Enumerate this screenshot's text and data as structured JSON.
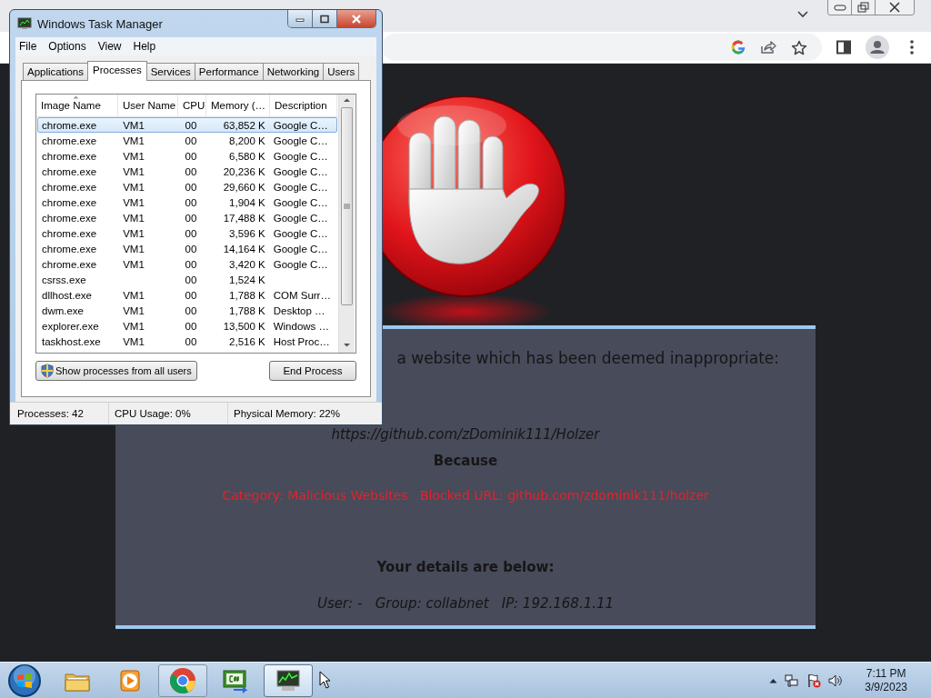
{
  "block_page": {
    "heading": "a website which has been deemed inappropriate:",
    "url": "https://github.com/zDominik111/Holzer",
    "because": "Because",
    "reason": "Category: Malicious Websites   Blocked URL: github.com/zdominik111/holzer",
    "details_heading": "Your details are below:",
    "details": "User: -   Group: collabnet   IP: 192.168.1.11"
  },
  "task_manager": {
    "title": "Windows Task Manager",
    "menu": [
      "File",
      "Options",
      "View",
      "Help"
    ],
    "tabs": [
      {
        "label": "Applications",
        "selected": false
      },
      {
        "label": "Processes",
        "selected": true
      },
      {
        "label": "Services",
        "selected": false
      },
      {
        "label": "Performance",
        "selected": false
      },
      {
        "label": "Networking",
        "selected": false
      },
      {
        "label": "Users",
        "selected": false
      }
    ],
    "columns": [
      {
        "label": "Image Name",
        "sorted": true
      },
      {
        "label": "User Name",
        "sorted": false
      },
      {
        "label": "CPU",
        "sorted": false
      },
      {
        "label": "Memory (…",
        "sorted": false
      },
      {
        "label": "Description",
        "sorted": false
      }
    ],
    "rows": [
      {
        "cells": [
          "chrome.exe",
          "VM1",
          "00",
          "63,852 K",
          "Google C…"
        ],
        "selected": true
      },
      {
        "cells": [
          "chrome.exe",
          "VM1",
          "00",
          "8,200 K",
          "Google C…"
        ],
        "selected": false
      },
      {
        "cells": [
          "chrome.exe",
          "VM1",
          "00",
          "6,580 K",
          "Google C…"
        ],
        "selected": false
      },
      {
        "cells": [
          "chrome.exe",
          "VM1",
          "00",
          "20,236 K",
          "Google C…"
        ],
        "selected": false
      },
      {
        "cells": [
          "chrome.exe",
          "VM1",
          "00",
          "29,660 K",
          "Google C…"
        ],
        "selected": false
      },
      {
        "cells": [
          "chrome.exe",
          "VM1",
          "00",
          "1,904 K",
          "Google C…"
        ],
        "selected": false
      },
      {
        "cells": [
          "chrome.exe",
          "VM1",
          "00",
          "17,488 K",
          "Google C…"
        ],
        "selected": false
      },
      {
        "cells": [
          "chrome.exe",
          "VM1",
          "00",
          "3,596 K",
          "Google C…"
        ],
        "selected": false
      },
      {
        "cells": [
          "chrome.exe",
          "VM1",
          "00",
          "14,164 K",
          "Google C…"
        ],
        "selected": false
      },
      {
        "cells": [
          "chrome.exe",
          "VM1",
          "00",
          "3,420 K",
          "Google C…"
        ],
        "selected": false
      },
      {
        "cells": [
          "csrss.exe",
          "",
          "00",
          "1,524 K",
          ""
        ],
        "selected": false
      },
      {
        "cells": [
          "dllhost.exe",
          "VM1",
          "00",
          "1,788 K",
          "COM Surr…"
        ],
        "selected": false
      },
      {
        "cells": [
          "dwm.exe",
          "VM1",
          "00",
          "1,788 K",
          "Desktop …"
        ],
        "selected": false
      },
      {
        "cells": [
          "explorer.exe",
          "VM1",
          "00",
          "13,500 K",
          "Windows …"
        ],
        "selected": false
      },
      {
        "cells": [
          "taskhost.exe",
          "VM1",
          "00",
          "2,516 K",
          "Host Proc…"
        ],
        "selected": false
      }
    ],
    "buttons": [
      {
        "kind": "shield",
        "label": "Show processes from all users"
      },
      {
        "kind": "plain",
        "label": "End Process"
      }
    ],
    "status": [
      "Processes: 42",
      "CPU Usage: 0%",
      "Physical Memory: 22%"
    ]
  },
  "taskbar": {
    "apps": [
      {
        "kind": "folder",
        "open": false,
        "selected": false
      },
      {
        "kind": "media",
        "open": false,
        "selected": false
      },
      {
        "kind": "chrome",
        "open": true,
        "selected": false
      },
      {
        "kind": "csharp",
        "open": false,
        "selected": false
      },
      {
        "kind": "monitor",
        "open": true,
        "selected": true
      }
    ],
    "time": "7:11 PM",
    "date": "3/9/2023"
  }
}
